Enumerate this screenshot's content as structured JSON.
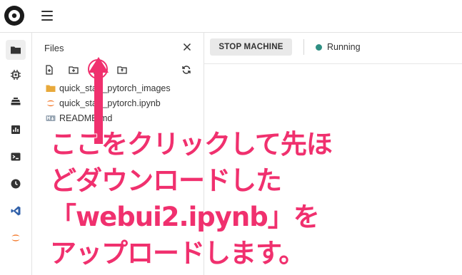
{
  "topbar": {
    "logo_icon": "app-logo-icon",
    "menu_icon": "hamburger-menu-icon"
  },
  "rail": {
    "items": [
      {
        "icon": "folder-icon",
        "active": true
      },
      {
        "icon": "chip-icon",
        "active": false
      },
      {
        "icon": "stack-icon",
        "active": false
      },
      {
        "icon": "bar-chart-icon",
        "active": false
      },
      {
        "icon": "terminal-icon",
        "active": false
      },
      {
        "icon": "clock-icon",
        "active": false
      },
      {
        "icon": "vscode-icon",
        "active": false
      },
      {
        "icon": "jupyter-icon",
        "active": false
      }
    ]
  },
  "files": {
    "title": "Files",
    "toolbar": [
      "new-file-icon",
      "new-folder-icon",
      "upload-icon",
      "folder-plus-icon",
      "refresh-icon"
    ],
    "items": [
      {
        "name": "quick_start_pytorch_images",
        "icon": "folder-icon"
      },
      {
        "name": "quick_start_pytorch.ipynb",
        "icon": "notebook-icon"
      },
      {
        "name": "README.md",
        "icon": "markdown-icon"
      }
    ]
  },
  "main": {
    "stop_button": "STOP MACHINE",
    "status": "Running",
    "status_color": "#2f8f83"
  },
  "annotation": {
    "lines": [
      "ここをクリックして先ほ",
      "どダウンロードした",
      "「webui2.ipynb」を",
      "アップロードします。"
    ],
    "color": "#f0306e"
  }
}
